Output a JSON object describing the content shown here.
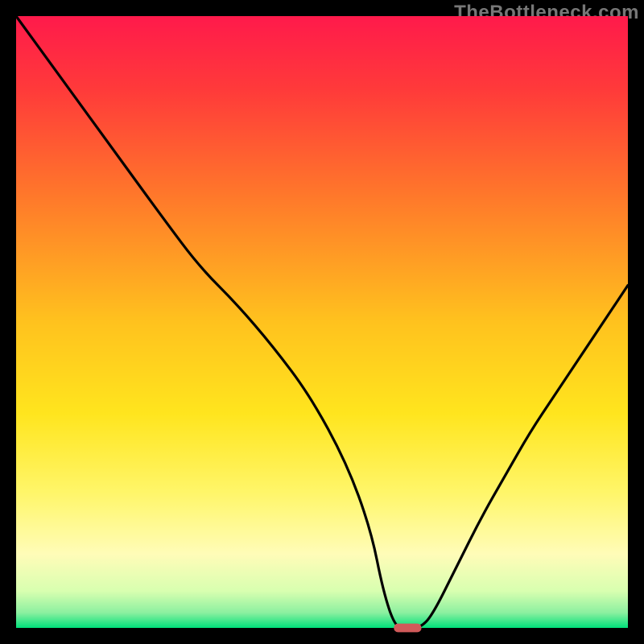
{
  "watermark": {
    "text": "TheBottleneck.com"
  },
  "chart_data": {
    "type": "line",
    "title": "",
    "xlabel": "",
    "ylabel": "",
    "xlim": [
      0,
      100
    ],
    "ylim": [
      0,
      100
    ],
    "grid": false,
    "legend_position": "none",
    "gradient_stops": [
      {
        "offset": 0.0,
        "color": "#ff1a4b"
      },
      {
        "offset": 0.12,
        "color": "#ff3a3a"
      },
      {
        "offset": 0.3,
        "color": "#ff7a2a"
      },
      {
        "offset": 0.5,
        "color": "#ffc21e"
      },
      {
        "offset": 0.65,
        "color": "#ffe51e"
      },
      {
        "offset": 0.78,
        "color": "#fff66a"
      },
      {
        "offset": 0.88,
        "color": "#fffcb8"
      },
      {
        "offset": 0.94,
        "color": "#d8ffb0"
      },
      {
        "offset": 0.975,
        "color": "#8cf0a0"
      },
      {
        "offset": 1.0,
        "color": "#00e07a"
      }
    ],
    "curve": {
      "x": [
        0,
        8,
        16,
        24,
        30,
        36,
        42,
        48,
        54,
        58,
        60,
        62,
        64,
        66,
        68,
        72,
        76,
        80,
        84,
        88,
        92,
        96,
        100
      ],
      "y": [
        100,
        89,
        78,
        67,
        59,
        53,
        46,
        38,
        27,
        16,
        6,
        0,
        0,
        0,
        2,
        10,
        18,
        25,
        32,
        38,
        44,
        50,
        56
      ]
    },
    "marker": {
      "x_center": 64.0,
      "y_center": 0.0,
      "width_pct": 4.5,
      "height_pct": 1.4,
      "color": "#d05a5a",
      "corner_radius": 5
    }
  }
}
